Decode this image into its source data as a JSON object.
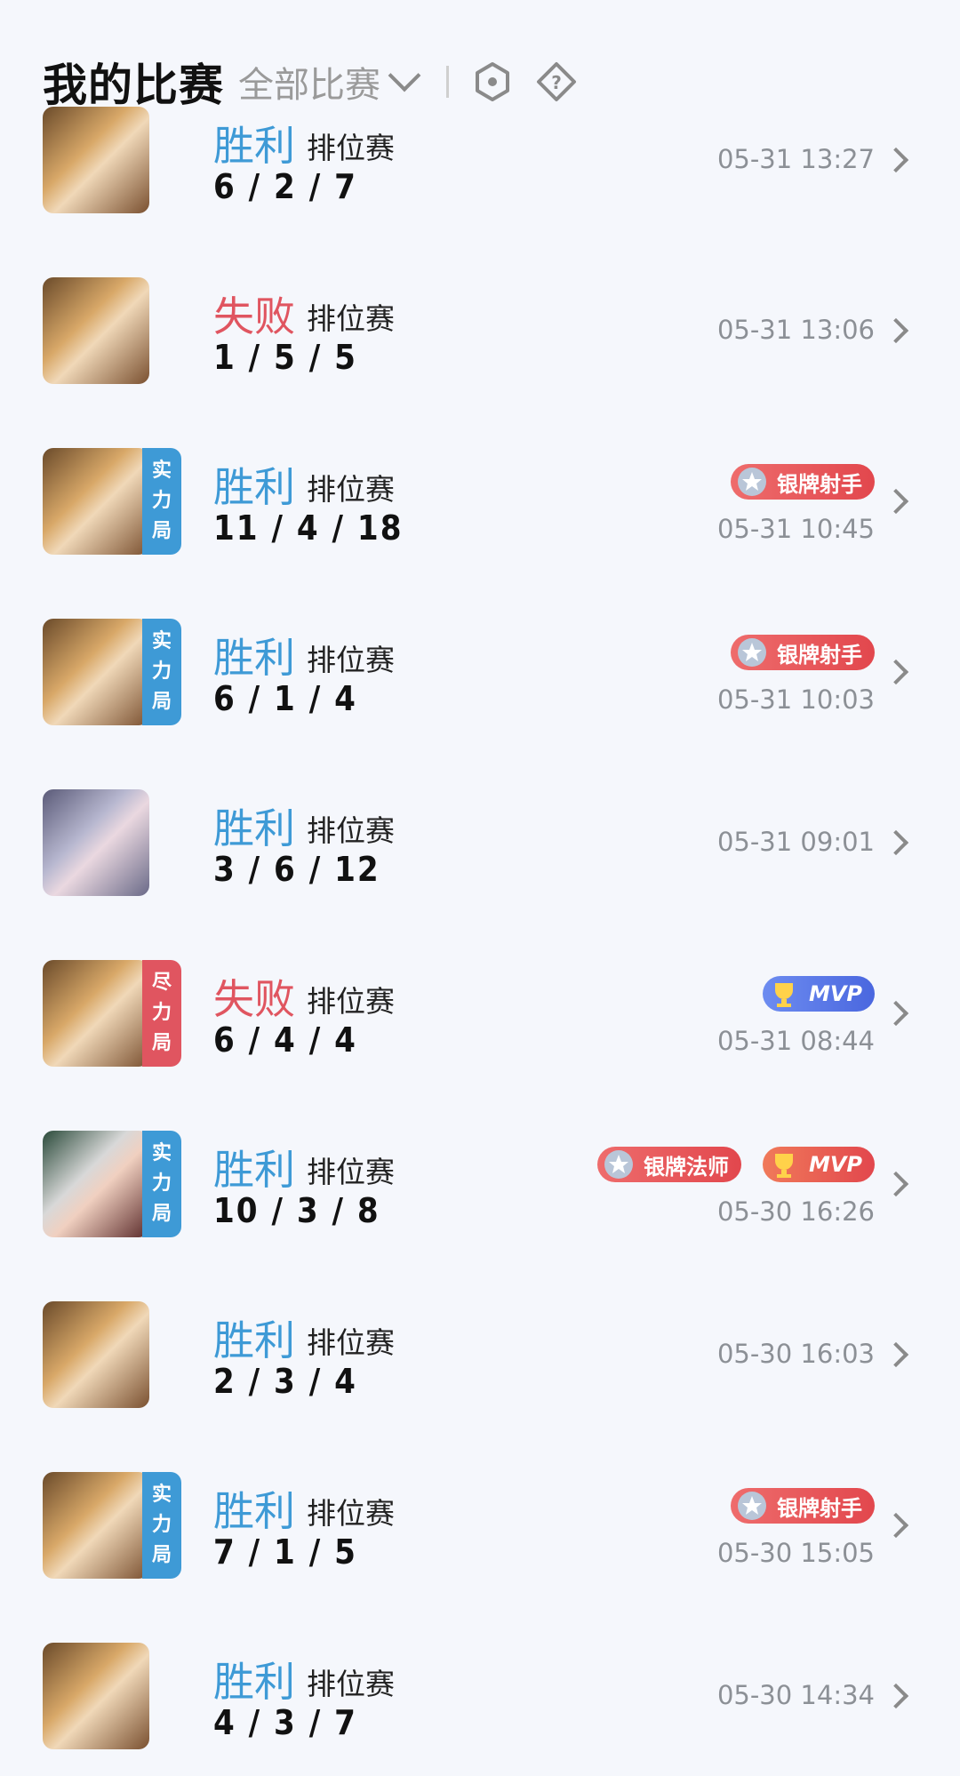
{
  "header": {
    "title": "我的比赛",
    "filter_label": "全部比赛"
  },
  "colors": {
    "win": "#3e9ad6",
    "loss": "#e05560",
    "tag_strength": "#3e9ad6",
    "tag_effort": "#e05560"
  },
  "matches": [
    {
      "result": "胜利",
      "mode": "排位赛",
      "kda": "6 / 2 / 7",
      "time": "05-31 13:27",
      "tag": "",
      "badges": []
    },
    {
      "result": "失败",
      "mode": "排位赛",
      "kda": "1 / 5 / 5",
      "time": "05-31 13:06",
      "tag": "",
      "badges": []
    },
    {
      "result": "胜利",
      "mode": "排位赛",
      "kda": "11 / 4 / 18",
      "time": "05-31 10:45",
      "tag": "实力局",
      "badges": [
        "银牌射手"
      ]
    },
    {
      "result": "胜利",
      "mode": "排位赛",
      "kda": "6 / 1 / 4",
      "time": "05-31 10:03",
      "tag": "实力局",
      "badges": [
        "银牌射手"
      ]
    },
    {
      "result": "胜利",
      "mode": "排位赛",
      "kda": "3 / 6 / 12",
      "time": "05-31 09:01",
      "tag": "",
      "badges": []
    },
    {
      "result": "失败",
      "mode": "排位赛",
      "kda": "6 / 4 / 4",
      "time": "05-31 08:44",
      "tag": "尽力局",
      "badges": [
        "MVP"
      ]
    },
    {
      "result": "胜利",
      "mode": "排位赛",
      "kda": "10 / 3 / 8",
      "time": "05-30 16:26",
      "tag": "实力局",
      "badges": [
        "银牌法师",
        "MVP"
      ]
    },
    {
      "result": "胜利",
      "mode": "排位赛",
      "kda": "2 / 3 / 4",
      "time": "05-30 16:03",
      "tag": "",
      "badges": []
    },
    {
      "result": "胜利",
      "mode": "排位赛",
      "kda": "7 / 1 / 5",
      "time": "05-30 15:05",
      "tag": "实力局",
      "badges": [
        "银牌射手"
      ]
    },
    {
      "result": "胜利",
      "mode": "排位赛",
      "kda": "4 / 3 / 7",
      "time": "05-30 14:34",
      "tag": "",
      "badges": []
    }
  ]
}
